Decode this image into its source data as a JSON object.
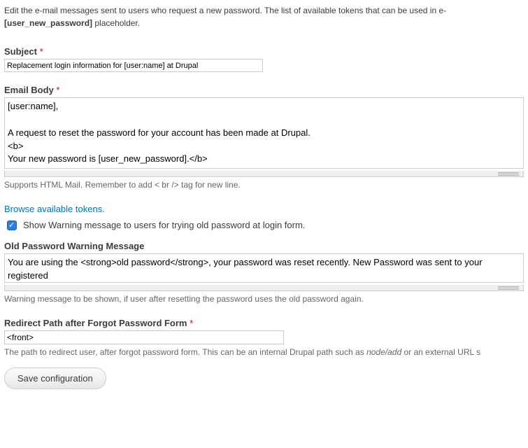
{
  "intro": {
    "line1": "Edit the e-mail messages sent to users who request a new password. The list of available tokens that can be used in e-",
    "bold_token": "[user_new_password]",
    "after_bold": " placeholder."
  },
  "subject": {
    "label": "Subject",
    "required": "*",
    "value": "Replacement login information for [user:name] at Drupal"
  },
  "body": {
    "label": "Email Body",
    "required": "*",
    "value": "[user:name],\n\nA request to reset the password for your account has been made at Drupal.\n<b>\nYour new password is [user_new_password].</b>",
    "help": "Supports HTML Mail. Remember to add < br /> tag for new line."
  },
  "tokens_link": "Browse available tokens.",
  "show_warning": {
    "label": "Show Warning message to users for trying old password at login form.",
    "checked": true
  },
  "old_pw_msg": {
    "label": "Old Password Warning Message",
    "value": "You are using the <strong>old password</strong>, your password was reset recently. New Password was sent to your registered",
    "help": "Warning message to be shown, if user after resetting the password uses the old password again."
  },
  "redirect": {
    "label": "Redirect Path after Forgot Password Form",
    "required": "*",
    "value": "<front>",
    "help_pre": "The path to redirect user, after forgot password form. This can be an internal Drupal path such as ",
    "help_em": "node/add",
    "help_post": " or an external URL s"
  },
  "submit_label": "Save configuration"
}
